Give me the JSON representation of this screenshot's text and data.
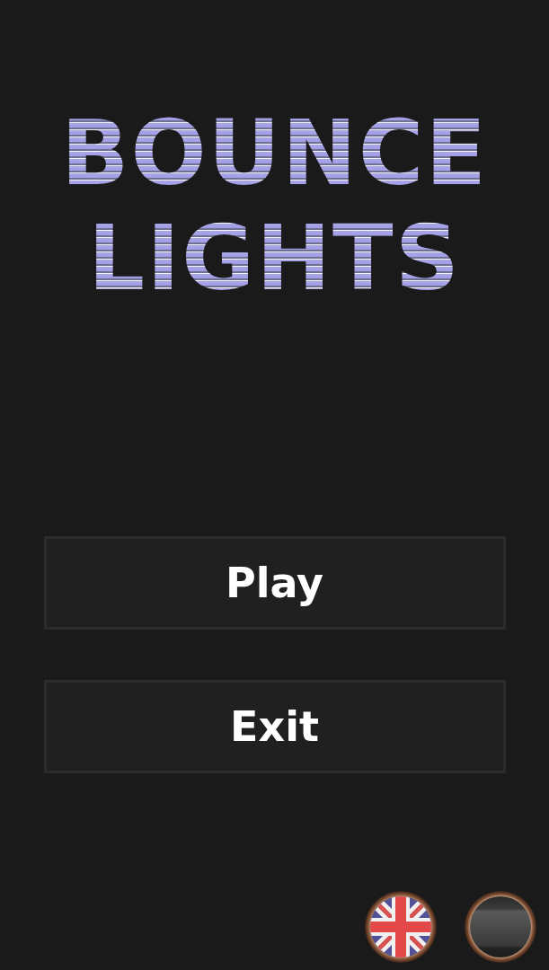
{
  "title": "BOUNCE LIGHTS",
  "menu": [
    {
      "label": "Play"
    },
    {
      "label": "Exit"
    }
  ]
}
